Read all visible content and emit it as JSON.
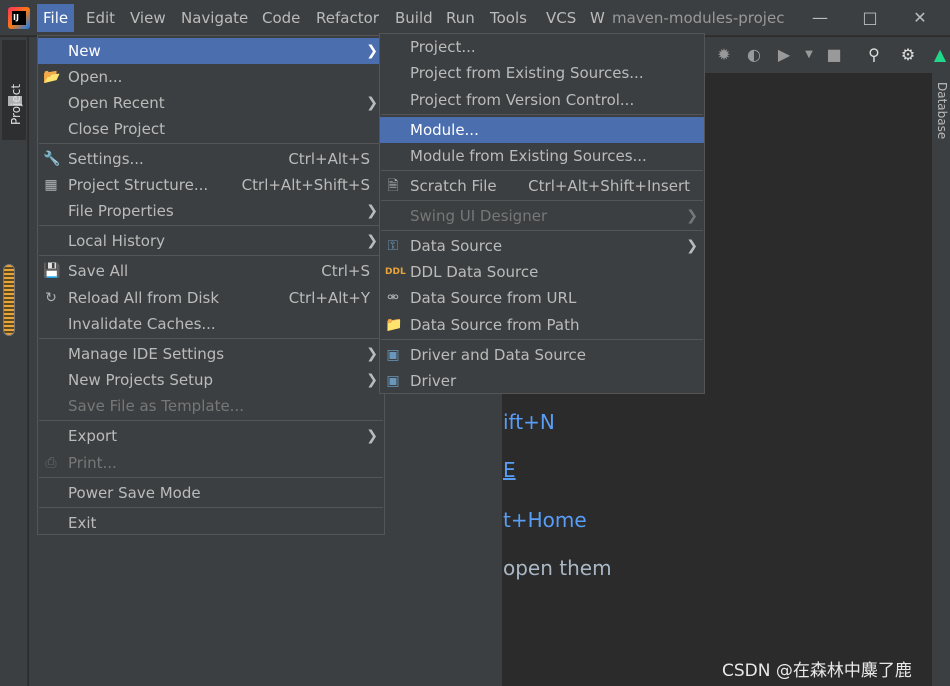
{
  "menubar": {
    "items": [
      {
        "label": "File",
        "active": true
      },
      {
        "label": "Edit"
      },
      {
        "label": "View"
      },
      {
        "label": "Navigate"
      },
      {
        "label": "Code"
      },
      {
        "label": "Refactor"
      },
      {
        "label": "Build"
      },
      {
        "label": "Run"
      },
      {
        "label": "Tools"
      },
      {
        "label": "VCS"
      },
      {
        "label": "W"
      }
    ],
    "window_title": "maven-modules-projec"
  },
  "sidebar": {
    "project_tab": "Project",
    "database_tab": "Database"
  },
  "file_menu": {
    "items": [
      {
        "label": "New",
        "shortcut": "",
        "submenu": true,
        "selected": true
      },
      {
        "label": "Open...",
        "icon": "folder-open-icon"
      },
      {
        "label": "Open Recent",
        "submenu": true
      },
      {
        "label": "Close Project"
      },
      {
        "label": "Settings...",
        "shortcut": "Ctrl+Alt+S",
        "icon": "wrench-icon"
      },
      {
        "label": "Project Structure...",
        "shortcut": "Ctrl+Alt+Shift+S",
        "icon": "project-structure-icon"
      },
      {
        "label": "File Properties",
        "submenu": true
      },
      {
        "label": "Local History",
        "submenu": true
      },
      {
        "label": "Save All",
        "shortcut": "Ctrl+S",
        "icon": "save-icon"
      },
      {
        "label": "Reload All from Disk",
        "shortcut": "Ctrl+Alt+Y",
        "icon": "reload-icon"
      },
      {
        "label": "Invalidate Caches..."
      },
      {
        "label": "Manage IDE Settings",
        "submenu": true
      },
      {
        "label": "New Projects Setup",
        "submenu": true
      },
      {
        "label": "Save File as Template...",
        "disabled": true
      },
      {
        "label": "Export",
        "submenu": true
      },
      {
        "label": "Print...",
        "disabled": true,
        "icon": "print-icon"
      },
      {
        "label": "Power Save Mode"
      },
      {
        "label": "Exit"
      }
    ]
  },
  "new_submenu": {
    "items": [
      {
        "label": "Project..."
      },
      {
        "label": "Project from Existing Sources..."
      },
      {
        "label": "Project from Version Control..."
      },
      {
        "label": "Module...",
        "selected": true
      },
      {
        "label": "Module from Existing Sources..."
      },
      {
        "label": "Scratch File",
        "shortcut": "Ctrl+Alt+Shift+Insert",
        "icon": "scratch-file-icon"
      },
      {
        "label": "Swing UI Designer",
        "submenu": true,
        "disabled": true
      },
      {
        "label": "Data Source",
        "submenu": true,
        "icon": "database-icon"
      },
      {
        "label": "DDL Data Source",
        "icon": "ddl-icon"
      },
      {
        "label": "Data Source from URL",
        "icon": "plug-icon"
      },
      {
        "label": "Data Source from Path",
        "icon": "folder-icon"
      },
      {
        "label": "Driver and Data Source",
        "icon": "driver-icon"
      },
      {
        "label": "Driver",
        "icon": "driver-icon"
      }
    ]
  },
  "editor_hints": {
    "hint1": "ift+N",
    "hint2": "E",
    "hint3": "t+Home",
    "hint4": "open them"
  },
  "watermark": "CSDN @在森林中麋了鹿",
  "colors": {
    "menubar_bg": "#3c3f41",
    "editor_bg": "#2b2b2b",
    "selection": "#4b6eaf",
    "hint_blue": "#589df6"
  }
}
